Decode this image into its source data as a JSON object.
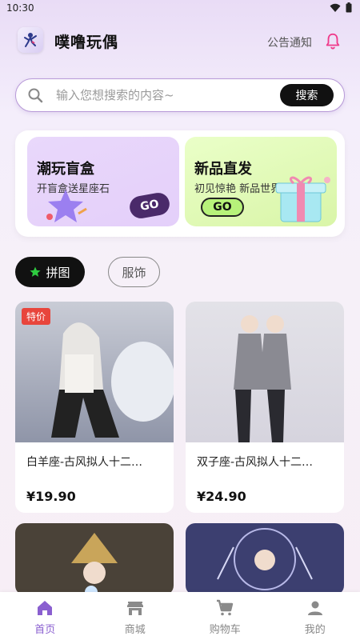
{
  "status": {
    "time": "10:30"
  },
  "header": {
    "title": "噗噜玩偶",
    "notice": "公告通知"
  },
  "search": {
    "placeholder": "输入您想搜索的内容~",
    "button": "搜索"
  },
  "promos": [
    {
      "title": "潮玩盲盒",
      "subtitle": "开盲盒送星座石",
      "badge": "GO"
    },
    {
      "title": "新品直发",
      "subtitle": "初见惊艳 新品世界",
      "badge": "GO"
    }
  ],
  "tabs": [
    {
      "label": "拼图"
    },
    {
      "label": "服饰"
    }
  ],
  "products": [
    {
      "name": "白羊座-古风拟人十二…",
      "price": "¥19.90",
      "badge": "特价"
    },
    {
      "name": "双子座-古风拟人十二…",
      "price": "¥24.90"
    }
  ],
  "nav": [
    {
      "label": "首页",
      "icon": "home-icon"
    },
    {
      "label": "商城",
      "icon": "shop-icon"
    },
    {
      "label": "购物车",
      "icon": "cart-icon"
    },
    {
      "label": "我的",
      "icon": "user-icon"
    }
  ],
  "colors": {
    "accent": "#8a5fd0",
    "sale": "#e8453c",
    "bell": "#ef3a8a"
  }
}
